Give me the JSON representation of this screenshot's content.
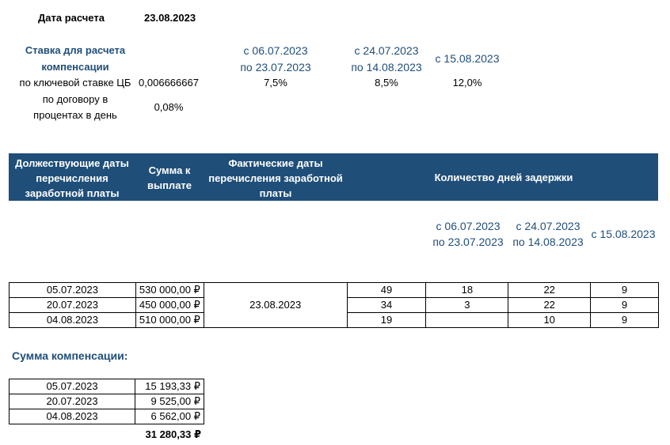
{
  "calc": {
    "label": "Дата расчета",
    "value": "23.08.2023"
  },
  "rate": {
    "title_line1": "Ставка для расчета",
    "title_line2": "компенсации",
    "cb_label": "по ключевой ставке ЦБ",
    "cb_value": "0,006666667",
    "contract_label_line1": "по договору в",
    "contract_label_line2": "процентах в день",
    "contract_value": "0,08%",
    "periods": [
      {
        "from": "с 06.07.2023",
        "to": "по 23.07.2023",
        "rate": "7,5%"
      },
      {
        "from": "с 24.07.2023",
        "to": "по 14.08.2023",
        "rate": "8,5%"
      },
      {
        "from": "с 15.08.2023",
        "to": "",
        "rate": "12,0%"
      }
    ]
  },
  "table_header": {
    "col1": "Должествующие даты перечисления заработной платы",
    "col2": "Сумма к выплате",
    "col3": "Фактические даты перечисления заработной платы",
    "col4": "Количество дней задержки"
  },
  "delay_periods": [
    {
      "from": "с 06.07.2023",
      "to": "по 23.07.2023"
    },
    {
      "from": "с 24.07.2023",
      "to": "по 14.08.2023"
    },
    {
      "from": "с 15.08.2023",
      "to": ""
    }
  ],
  "rows": [
    {
      "due": "05.07.2023",
      "amount": "530 000,00 ₽",
      "total_days": "49",
      "p1": "18",
      "p2": "22",
      "p3": "9"
    },
    {
      "due": "20.07.2023",
      "amount": "450 000,00 ₽",
      "total_days": "34",
      "p1": "3",
      "p2": "22",
      "p3": "9"
    },
    {
      "due": "04.08.2023",
      "amount": "510 000,00 ₽",
      "total_days": "19",
      "p1": "",
      "p2": "10",
      "p3": "9"
    }
  ],
  "actual_date": "23.08.2023",
  "compensation": {
    "title": "Сумма компенсации:",
    "rows": [
      {
        "date": "05.07.2023",
        "amount": "15 193,33 ₽"
      },
      {
        "date": "20.07.2023",
        "amount": "9 525,00 ₽"
      },
      {
        "date": "04.08.2023",
        "amount": "6 562,00 ₽"
      }
    ],
    "total": "31 280,33 ₽"
  }
}
